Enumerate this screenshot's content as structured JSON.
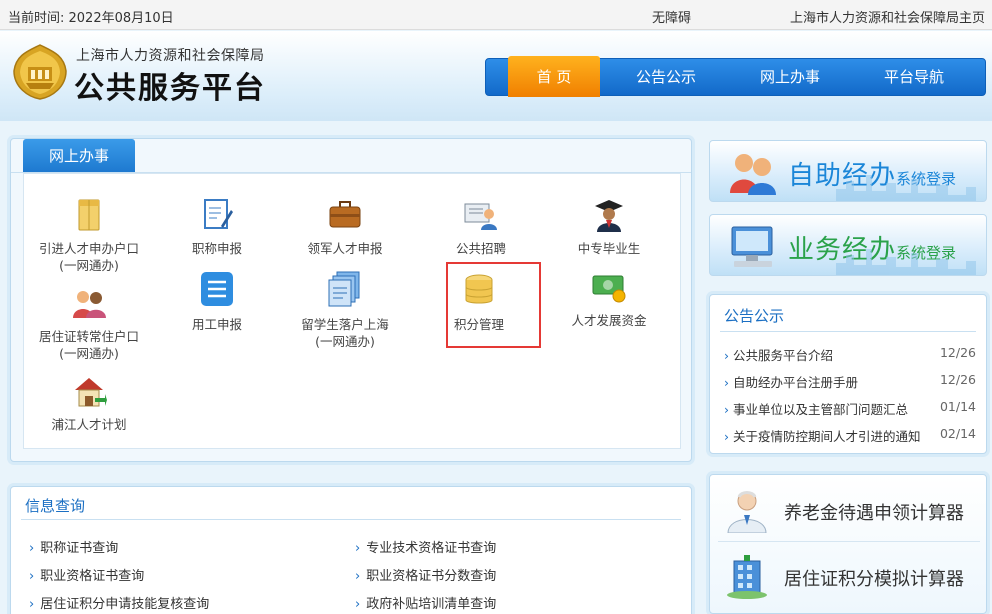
{
  "topbar": {
    "date": "当前时间:  2022年08月10日",
    "accessibility": "无障碍",
    "home_link": "上海市人力资源和社会保障局主页"
  },
  "header": {
    "org": "上海市人力资源和社会保障局",
    "platform": "公共服务平台"
  },
  "nav": [
    "首 页",
    "公告公示",
    "网上办事",
    "平台导航"
  ],
  "online": {
    "tab": "网上办事",
    "services": [
      {
        "l1": "引进人才申办户口",
        "l2": "(一网通办)",
        "icon": "folder-icon"
      },
      {
        "l1": "职称申报",
        "l2": "",
        "icon": "document-pen-icon"
      },
      {
        "l1": "领军人才申报",
        "l2": "",
        "icon": "briefcase-icon"
      },
      {
        "l1": "公共招聘",
        "l2": "",
        "icon": "recruit-icon"
      },
      {
        "l1": "中专毕业生",
        "l2": "",
        "icon": "graduate-icon"
      },
      {
        "l1": "居住证转常住户口",
        "l2": "(一网通办)",
        "icon": "people-icon"
      },
      {
        "l1": "用工申报",
        "l2": "",
        "icon": "list-icon"
      },
      {
        "l1": "留学生落户上海",
        "l2": "(一网通办)",
        "icon": "documents-icon"
      },
      {
        "l1": "积分管理",
        "l2": "",
        "icon": "database-icon"
      },
      {
        "l1": "人才发展资金",
        "l2": "",
        "icon": "money-icon"
      },
      {
        "l1": "浦江人才计划",
        "l2": "",
        "icon": "house-icon"
      }
    ]
  },
  "login": {
    "self_big": "自助经办",
    "self_small": "系统登录",
    "biz_big": "业务经办",
    "biz_small": "系统登录"
  },
  "notice": {
    "title": "公告公示",
    "items": [
      {
        "text": "公共服务平台介绍",
        "date": "12/26"
      },
      {
        "text": "自助经办平台注册手册",
        "date": "12/26"
      },
      {
        "text": "事业单位以及主管部门问题汇总",
        "date": "01/14"
      },
      {
        "text": "关于疫情防控期间人才引进的通知",
        "date": "02/14"
      }
    ]
  },
  "calc": [
    "养老金待遇申领计算器",
    "居住证积分模拟计算器"
  ],
  "query": {
    "title": "信息查询",
    "items": [
      "职称证书查询",
      "专业技术资格证书查询",
      "职业资格证书查询",
      "职业资格证书分数查询",
      "居住证积分申请技能复核查询",
      "政府补贴培训清单查询"
    ]
  },
  "colors": {
    "nav_blue": "#1a78d6",
    "nav_active": "#f59a0c",
    "highlight": "#e53935"
  }
}
